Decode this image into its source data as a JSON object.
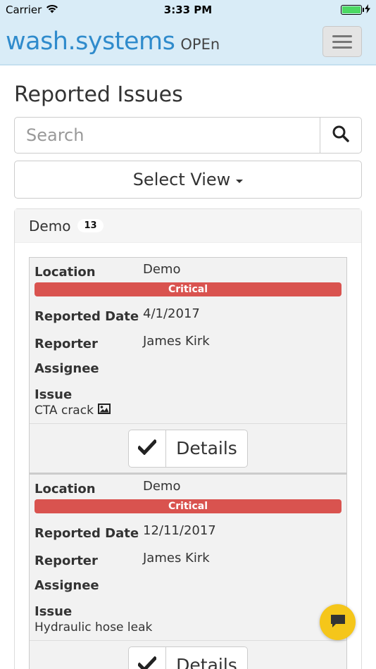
{
  "status_bar": {
    "carrier": "Carrier",
    "time": "3:33 PM"
  },
  "navbar": {
    "brand": "wash.systems",
    "brand_sub": "OPEn",
    "brand_color": "#2f8bcc"
  },
  "page": {
    "title": "Reported Issues"
  },
  "search": {
    "placeholder": "Search",
    "icon": "search-icon"
  },
  "select_view": {
    "label": "Select View"
  },
  "group": {
    "name": "Demo",
    "count": "13"
  },
  "labels": {
    "location": "Location",
    "reported_date": "Reported Date",
    "reporter": "Reporter",
    "assignee": "Assignee",
    "issue": "Issue",
    "details": "Details"
  },
  "issues": [
    {
      "location": "Demo",
      "priority": "Critical",
      "reported_date": "4/1/2017",
      "reporter": "James Kirk",
      "assignee": "",
      "issue": "CTA crack",
      "has_image": true
    },
    {
      "location": "Demo",
      "priority": "Critical",
      "reported_date": "12/11/2017",
      "reporter": "James Kirk",
      "assignee": "",
      "issue": "Hydraulic hose leak",
      "has_image": false
    }
  ],
  "colors": {
    "critical": "#d9534f",
    "chat": "#f5c61a",
    "navbar_bg": "#d9ecf7"
  }
}
